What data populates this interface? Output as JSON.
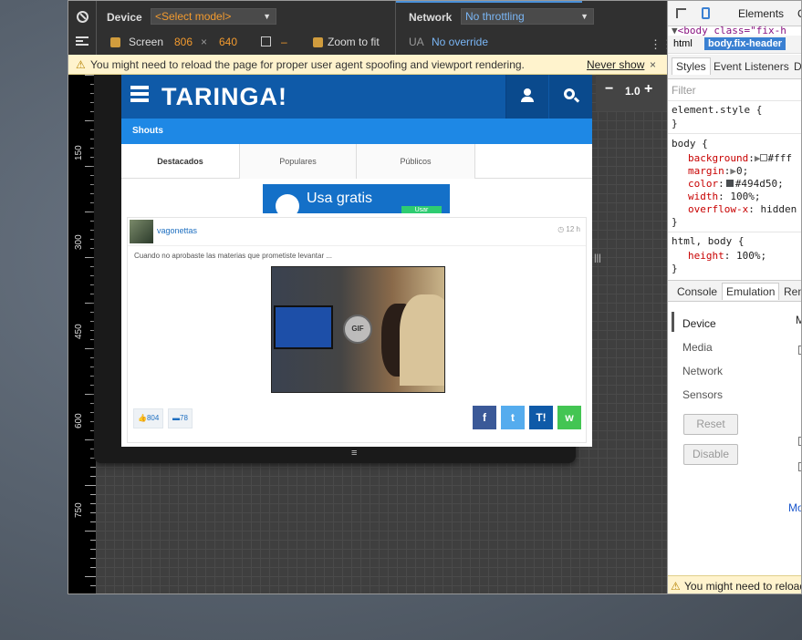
{
  "toolbar": {
    "device_label": "Device",
    "device_select": "<Select model>",
    "screen_label": "Screen",
    "screen_width": "806",
    "times": "×",
    "screen_height": "640",
    "swap_dash": "–",
    "zoom_to_fit_label": "Zoom to fit",
    "network_label": "Network",
    "network_select": "No throttling",
    "ua_label": "UA",
    "ua_value": "No override"
  },
  "warning": {
    "text": "You might need to reload the page for proper user agent spoofing and viewport rendering.",
    "never_show": "Never show",
    "close": "×"
  },
  "ruler": {
    "labels": [
      "150",
      "300",
      "450",
      "600",
      "750"
    ]
  },
  "zoom": {
    "minus": "−",
    "value": "1.0",
    "plus": "+"
  },
  "site": {
    "logo": "TARINGA!",
    "section": "Shouts",
    "tabs": [
      "Destacados",
      "Populares",
      "Públicos"
    ],
    "ad_text": "Usa gratis",
    "ad_button": "Usar",
    "post": {
      "user": "vagonettas",
      "time": "12 h",
      "text": "Cuando no aprobaste las materias que prometiste levantar ...",
      "gif_badge": "GIF",
      "likes": "804",
      "comments": "78"
    },
    "share": [
      "f",
      "t",
      "T!",
      "w"
    ]
  },
  "devtools": {
    "tabs": [
      "Elements",
      "C"
    ],
    "dom_line": "<body class=\"fix-h",
    "crumbs": [
      "html",
      "body.fix-header"
    ],
    "style_tabs": [
      "Styles",
      "Event Listeners",
      "DO"
    ],
    "filter_placeholder": "Filter",
    "css": {
      "element_style": "element.style {",
      "close": "}",
      "body_sel": "body {",
      "props": [
        {
          "name": "background",
          "value": "#fff"
        },
        {
          "name": "margin",
          "value": "0;"
        },
        {
          "name": "color",
          "value": "#494d50;"
        },
        {
          "name": "width",
          "value": "100%;"
        },
        {
          "name": "overflow-x",
          "value": "hidden"
        }
      ],
      "html_body_sel": "html, body {",
      "height_prop": "height",
      "height_val": "100%;"
    },
    "console_tabs": [
      "Console",
      "Emulation",
      "Ren"
    ],
    "emulation_nav": [
      "Device",
      "Media",
      "Network",
      "Sensors"
    ],
    "reset": "Reset",
    "disable": "Disable",
    "trailing_m": "M",
    "more": "Mo",
    "bottom_warning": "You might need to reload"
  },
  "colors": {
    "accent": "#f29a2e",
    "taringa_blue": "#0f5aa8",
    "shouts_bar": "#1e88e5"
  }
}
